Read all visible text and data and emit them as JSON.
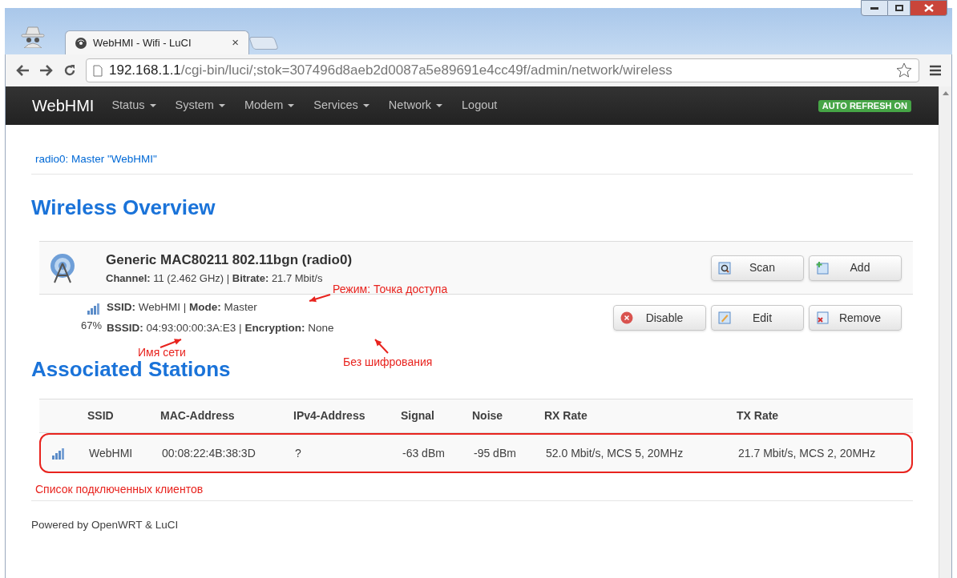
{
  "browser": {
    "tab_title": "WebHMI - Wifi - LuCI",
    "tab_close": "×",
    "url_host": "192.168.1.1",
    "url_path": "/cgi-bin/luci/;stok=307496d8aeb2d0087a5e89691e4cc49f/admin/network/wireless"
  },
  "nav": {
    "brand": "WebHMI",
    "menu": [
      {
        "label": "Status",
        "dropdown": true
      },
      {
        "label": "System",
        "dropdown": true
      },
      {
        "label": "Modem",
        "dropdown": true
      },
      {
        "label": "Services",
        "dropdown": true
      },
      {
        "label": "Network",
        "dropdown": true
      },
      {
        "label": "Logout",
        "dropdown": false
      }
    ],
    "badge": "AUTO REFRESH ON"
  },
  "breadcrumb": "radio0: Master \"WebHMI\"",
  "heading": "Wireless Overview",
  "device": {
    "name": "Generic MAC80211 802.11bgn (radio0)",
    "details": "**Channel:** 11 (2.462 GHz) | **Bitrate:** 21.7 Mbit/s",
    "buttons": [
      {
        "label": "Scan",
        "kind": "scan"
      },
      {
        "label": "Add",
        "kind": "add"
      }
    ]
  },
  "network": {
    "signal": "67%",
    "line_1": "**SSID:** WebHMI | **Mode:** Master",
    "line_2": "**BSSID:** 04:93:00:00:3A:E3 | **Encryption:** None",
    "buttons": [
      {
        "label": "Disable",
        "kind": "disable"
      },
      {
        "label": "Edit",
        "kind": "edit"
      },
      {
        "label": "Remove",
        "kind": "remove"
      }
    ]
  },
  "annotations": [
    {
      "text": "Режим: Точка доступа",
      "kind": "mode"
    },
    {
      "text": "Имя сети",
      "kind": "ssid"
    },
    {
      "text": "Без шифрования",
      "kind": "encryption"
    }
  ],
  "stations": {
    "heading": "Associated Stations",
    "columns": [
      "SSID",
      "MAC-Address",
      "IPv4-Address",
      "Signal",
      "Noise",
      "RX Rate",
      "TX Rate"
    ],
    "rows": [
      {
        "cells": [
          "WebHMI",
          "00:08:22:4B:38:3D",
          "?",
          "-63 dBm",
          "-95 dBm",
          "52.0 Mbit/s, MCS 5, 20MHz",
          "21.7 Mbit/s, MCS 2, 20MHz"
        ],
        "highlighted": true
      }
    ],
    "note": "Список подключенных клиентов"
  },
  "footer": "Powered by OpenWRT & LuCI"
}
